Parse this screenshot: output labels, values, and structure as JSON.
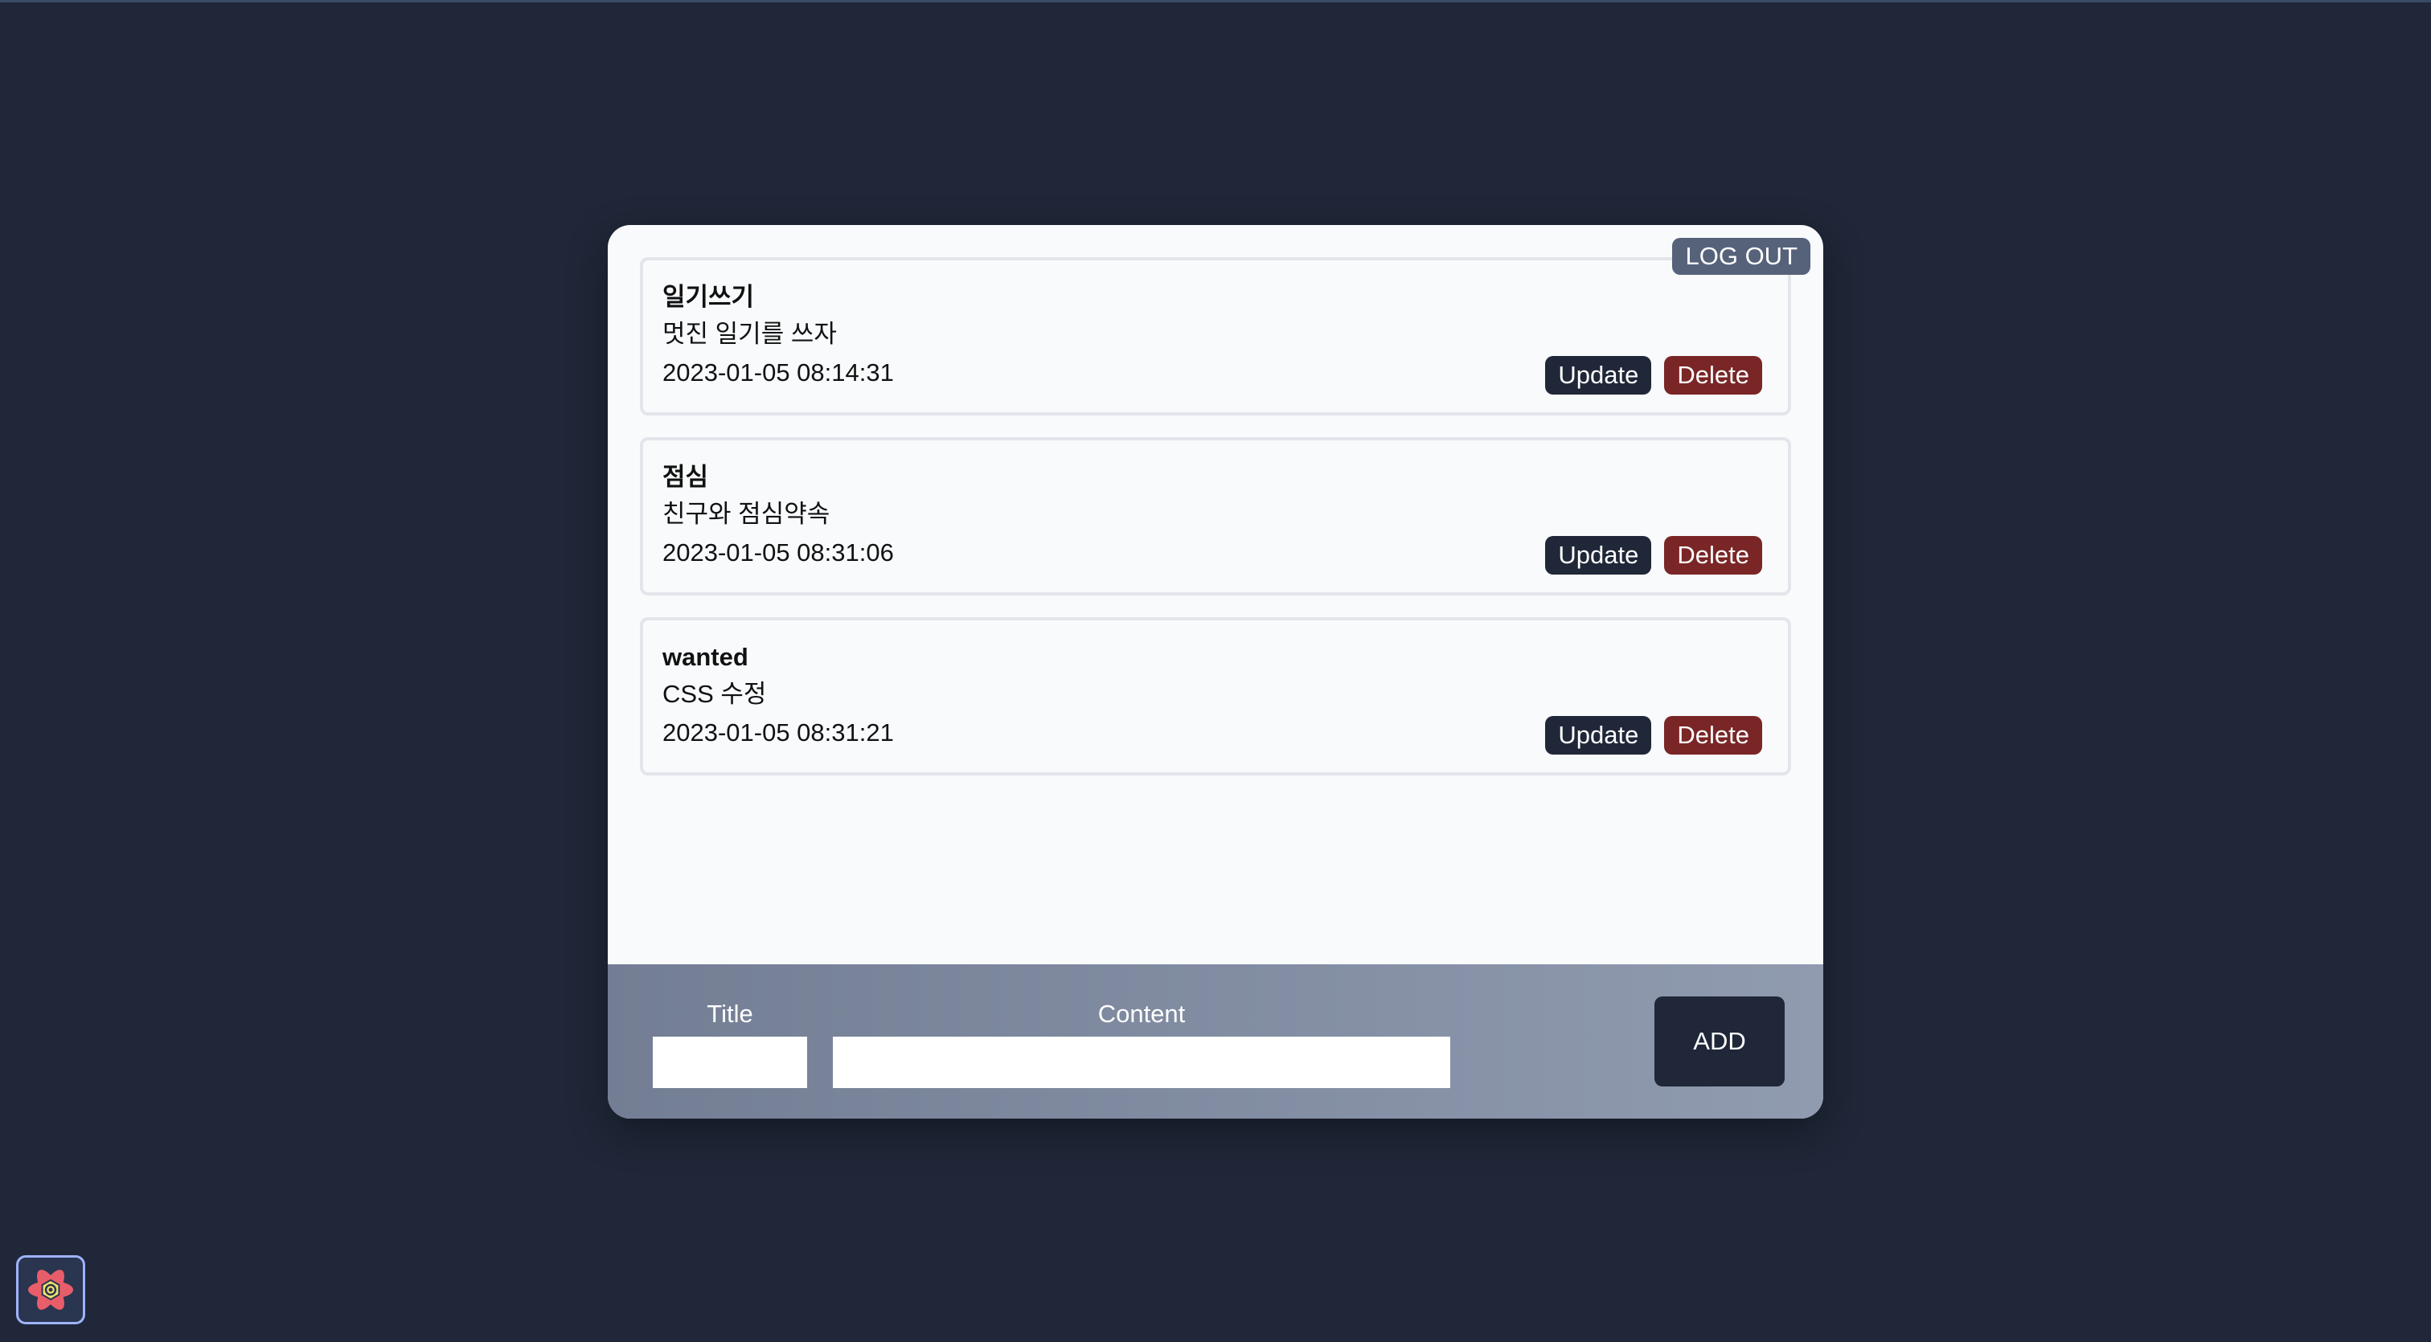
{
  "header": {
    "logout_label": "LOG OUT"
  },
  "todos": [
    {
      "title": "일기쓰기",
      "content": "멋진 일기를 쓰자",
      "date": "2023-01-05 08:14:31",
      "update_label": "Update",
      "delete_label": "Delete"
    },
    {
      "title": "점심",
      "content": "친구와 점심약속",
      "date": "2023-01-05 08:31:06",
      "update_label": "Update",
      "delete_label": "Delete"
    },
    {
      "title": "wanted",
      "content": "CSS 수정",
      "date": "2023-01-05 08:31:21",
      "update_label": "Update",
      "delete_label": "Delete"
    }
  ],
  "form": {
    "title_label": "Title",
    "title_value": "",
    "content_label": "Content",
    "content_value": "",
    "add_label": "ADD"
  },
  "devtools": {
    "icon": "react-devtools-icon"
  },
  "colors": {
    "page_background": "#1f2738",
    "card_background": "#f8fafc",
    "update_button": "#1f2738",
    "delete_button": "#7a2626",
    "logout_button": "#56627a",
    "footer_gradient_start": "#737e94",
    "footer_gradient_end": "#909bb0"
  }
}
